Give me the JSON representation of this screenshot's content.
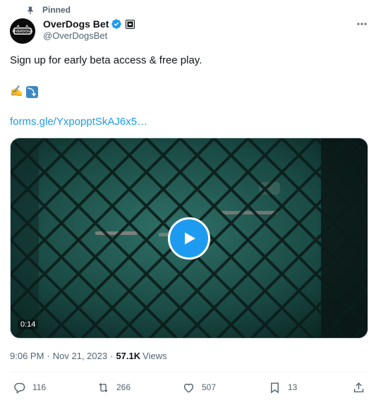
{
  "pinned": {
    "label": "Pinned",
    "icon": "pin-icon"
  },
  "author": {
    "display_name": "OverDogs Bet",
    "handle": "@OverDogsBet",
    "avatar_text": "OVERDOGS",
    "verified_icon": "verified-badge-icon",
    "affiliate_icon": "affiliate-badge-icon"
  },
  "tweet": {
    "text": "Sign up for early beta access & free play.",
    "emoji_1": "✍️",
    "emoji_2": "⤵",
    "link": "forms.gle/YxpopptSkAJ6x5…"
  },
  "video": {
    "duration": "0:14",
    "play_icon": "play-icon"
  },
  "meta": {
    "time": "9:06 PM",
    "date": "Nov 21, 2023",
    "separator": "·",
    "views_count": "57.1K",
    "views_label": "Views"
  },
  "actions": {
    "replies": "116",
    "reposts": "266",
    "likes": "507",
    "bookmarks": "13"
  },
  "colors": {
    "accent": "#1d9bf0",
    "text_primary": "#0f1419",
    "text_secondary": "#536471"
  }
}
